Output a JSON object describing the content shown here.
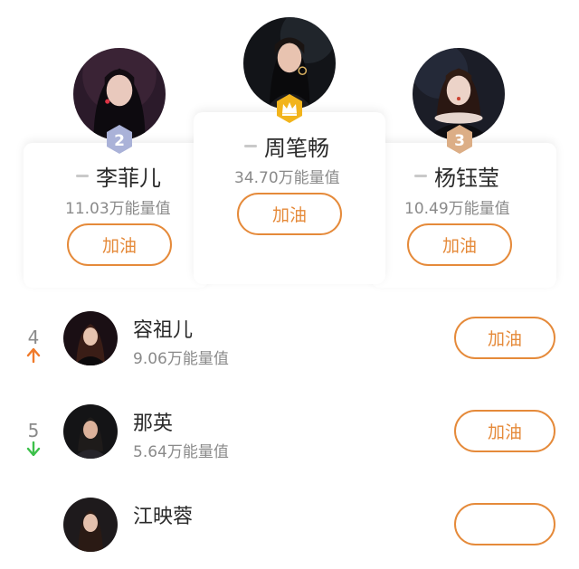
{
  "colors": {
    "accent": "#e58a3a",
    "rank_up": "#f07a2a",
    "rank_down": "#3cc04a",
    "badge_silver": "#aab2d8",
    "badge_gold": "#f2b41c",
    "badge_bronze": "#dcae86"
  },
  "podium": {
    "second": {
      "badge": "2",
      "name": "李菲儿",
      "score": "11.03万能量值",
      "button": "加油"
    },
    "first": {
      "badge_icon": "crown-icon",
      "name": "周笔畅",
      "score": "34.70万能量值",
      "button": "加油"
    },
    "third": {
      "badge": "3",
      "name": "杨钰莹",
      "score": "10.49万能量值",
      "button": "加油"
    }
  },
  "list": [
    {
      "rank": "4",
      "trend_icon": "arrow-up-icon",
      "name": "容祖儿",
      "score": "9.06万能量值",
      "button": "加油"
    },
    {
      "rank": "5",
      "trend_icon": "arrow-down-icon",
      "name": "那英",
      "score": "5.64万能量值",
      "button": "加油"
    },
    {
      "rank": "",
      "trend_icon": "",
      "name": "江映蓉",
      "score": "",
      "button": ""
    }
  ]
}
